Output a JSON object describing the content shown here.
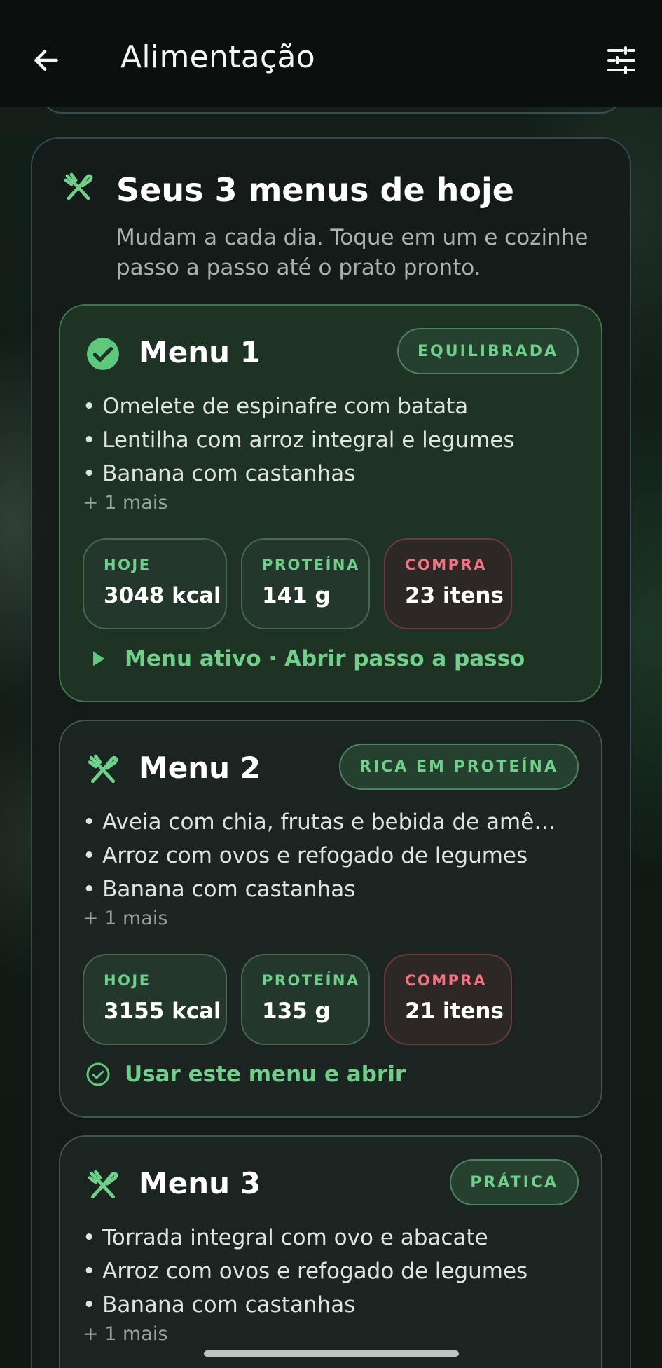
{
  "header": {
    "title": "Alimentação",
    "back_icon": "arrow-left-icon",
    "filter_icon": "sliders-icon"
  },
  "panel": {
    "title": "Seus 3 menus de hoje",
    "subtitle": "Mudam a cada dia. Toque em um e cozinhe passo a passo até o prato pronto.",
    "icon": "utensils-icon"
  },
  "menus": [
    {
      "title": "Menu 1",
      "tag": "EQUILIBRADA",
      "icon": "check-circle-icon",
      "active": true,
      "items": [
        "• Omelete de espinafre com batata",
        "• Lentilha com arroz integral e legumes",
        "• Banana com castanhas"
      ],
      "more": "+ 1 mais",
      "stats": [
        {
          "label": "HOJE",
          "value": "3048 kcal"
        },
        {
          "label": "PROTEÍNA",
          "value": "141 g"
        },
        {
          "label": "COMPRA",
          "value": "23 itens"
        }
      ],
      "action": "Menu ativo · Abrir passo a passo"
    },
    {
      "title": "Menu 2",
      "tag": "RICA EM PROTEÍNA",
      "icon": "utensils-icon",
      "active": false,
      "items": [
        "• Aveia com chia, frutas e bebida de amê…",
        "• Arroz com ovos e refogado de legumes",
        "• Banana com castanhas"
      ],
      "more": "+ 1 mais",
      "stats": [
        {
          "label": "HOJE",
          "value": "3155 kcal"
        },
        {
          "label": "PROTEÍNA",
          "value": "135 g"
        },
        {
          "label": "COMPRA",
          "value": "21 itens"
        }
      ],
      "action": "Usar este menu e abrir"
    },
    {
      "title": "Menu 3",
      "tag": "PRÁTICA",
      "icon": "utensils-icon",
      "active": false,
      "items": [
        "• Torrada integral com ovo e abacate",
        "• Arroz com ovos e refogado de legumes",
        "• Banana com castanhas"
      ],
      "more": "+ 1 mais"
    }
  ],
  "colors": {
    "accent": "#6fd089",
    "danger": "#f07481",
    "background": "#0d1512"
  }
}
